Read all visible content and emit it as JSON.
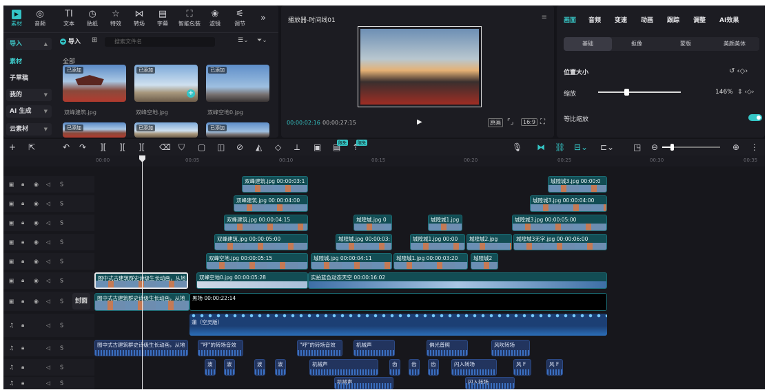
{
  "toolbar": {
    "tools": [
      {
        "label": "素材",
        "icon": "media-icon",
        "active": true
      },
      {
        "label": "音频",
        "icon": "audio-icon"
      },
      {
        "label": "文本",
        "icon": "text-icon"
      },
      {
        "label": "贴纸",
        "icon": "sticker-icon"
      },
      {
        "label": "特效",
        "icon": "effects-icon"
      },
      {
        "label": "转场",
        "icon": "transition-icon"
      },
      {
        "label": "字幕",
        "icon": "subtitle-icon"
      },
      {
        "label": "智能包装",
        "icon": "smart-pack-icon"
      },
      {
        "label": "滤镜",
        "icon": "filter-icon"
      },
      {
        "label": "调节",
        "icon": "adjust-icon"
      }
    ],
    "more": "»"
  },
  "sidebar": {
    "items": [
      {
        "label": "导入",
        "selected": true
      },
      {
        "label": "素材"
      },
      {
        "label": "子草稿"
      },
      {
        "label": "我的"
      },
      {
        "label": "AI 生成"
      },
      {
        "label": "云素材"
      }
    ]
  },
  "media": {
    "import_label": "导入",
    "search_placeholder": "搜索文件名",
    "section_label": "全部",
    "items": [
      {
        "tag": "已添加",
        "name": "双峰建筑.jpg"
      },
      {
        "tag": "已添加",
        "name": "双峰空地.jpg"
      },
      {
        "tag": "已添加",
        "name": "双峰空地0.jpg"
      },
      {
        "tag": "已添加",
        "name": ""
      },
      {
        "tag": "已添加",
        "name": ""
      },
      {
        "tag": "已添加",
        "name": ""
      }
    ]
  },
  "player": {
    "title": "播放器-时间线01",
    "current_time": "00:00:02:16",
    "total_time": "00:00:27:15",
    "buttons": [
      "原画",
      "16:9"
    ]
  },
  "inspector": {
    "tabs": [
      "画面",
      "音频",
      "变速",
      "动画",
      "跟踪",
      "调整",
      "AI效果"
    ],
    "subtabs": [
      "基础",
      "抠像",
      "蒙版",
      "美颜美体"
    ],
    "section": "位置大小",
    "scale_label": "缩放",
    "scale_value": "146%",
    "uniform_label": "等比缩放",
    "scale_fraction": 0.35
  },
  "ruler": {
    "ticks": [
      "00:00",
      "00:05",
      "00:10",
      "00:15",
      "00:20",
      "00:25",
      "00:30",
      "00:35"
    ]
  },
  "timeline": {
    "tool_badges": [
      "限免",
      "限免"
    ],
    "cover_label": "封面",
    "clips": [
      {
        "row": 0,
        "label": "双峰建筑.jpg  00:00:03:1"
      },
      {
        "row": 0,
        "label": "城隍城3.jpg  00:00:0"
      },
      {
        "row": 1,
        "label": "双峰建筑.jpg  00:00:04:00"
      },
      {
        "row": 1,
        "label": "城隍城3.jpg  00:00:04:00"
      },
      {
        "row": 2,
        "label": "双峰建筑.jpg  00:00:04:15"
      },
      {
        "row": 2,
        "label": "城隍城.jpg  0"
      },
      {
        "row": 2,
        "label": "城隍城1.jpg"
      },
      {
        "row": 2,
        "label": "城隍城3.jpg  00:00:05:00"
      },
      {
        "row": 3,
        "label": "双峰建筑.jpg  00:00:05:00"
      },
      {
        "row": 3,
        "label": "城隍城.jpg  00:00:03:"
      },
      {
        "row": 3,
        "label": "城隍城1.jpg  00:00"
      },
      {
        "row": 3,
        "label": "城隍城2.jpg"
      },
      {
        "row": 3,
        "label": "城隍城3无字.jpg  00:00:06:00"
      },
      {
        "row": 4,
        "label": "双峰空地.jpg  00:00:05:15"
      },
      {
        "row": 4,
        "label": "城隍城.jpg  00:00:04:11"
      },
      {
        "row": 4,
        "label": "城隍城1.jpg  00:00:03:20"
      },
      {
        "row": 4,
        "label": "城隍城2"
      },
      {
        "row": 5,
        "label": "图中式古建筑群史诗级生长动画，从地"
      },
      {
        "row": 5,
        "label": "双峰空地0.jpg  00:00:05:28"
      },
      {
        "row": 5,
        "label": "实拍蓝色动态天空  00:00:16:02"
      },
      {
        "row": 6,
        "label": "图中式古建筑群史诗级生长动画，从地"
      },
      {
        "row": 6,
        "label": "黑场  00:00:22:14"
      }
    ],
    "music_label": "蒲（空灵版）",
    "audio": [
      {
        "row": 8,
        "label": "图中式古建筑群史诗级生长动画，从地"
      },
      {
        "row": 8,
        "label": "\"呼\"的转场音效"
      },
      {
        "row": 8,
        "label": "\"呼\"的转场音效"
      },
      {
        "row": 8,
        "label": "机械声"
      },
      {
        "row": 8,
        "label": "佛光普照"
      },
      {
        "row": 8,
        "label": "风吹转场"
      },
      {
        "row": 9,
        "label": "波"
      },
      {
        "row": 9,
        "label": "波"
      },
      {
        "row": 9,
        "label": "波"
      },
      {
        "row": 9,
        "label": "波"
      },
      {
        "row": 9,
        "label": "机械声"
      },
      {
        "row": 9,
        "label": "齿"
      },
      {
        "row": 9,
        "label": "齿"
      },
      {
        "row": 9,
        "label": "齿"
      },
      {
        "row": 9,
        "label": "闪入转场"
      },
      {
        "row": 9,
        "label": "风 F"
      },
      {
        "row": 9,
        "label": "风 F"
      },
      {
        "row": 10,
        "label": "机械声"
      },
      {
        "row": 10,
        "label": "闪入转场"
      }
    ],
    "track_head": [
      "S"
    ]
  }
}
